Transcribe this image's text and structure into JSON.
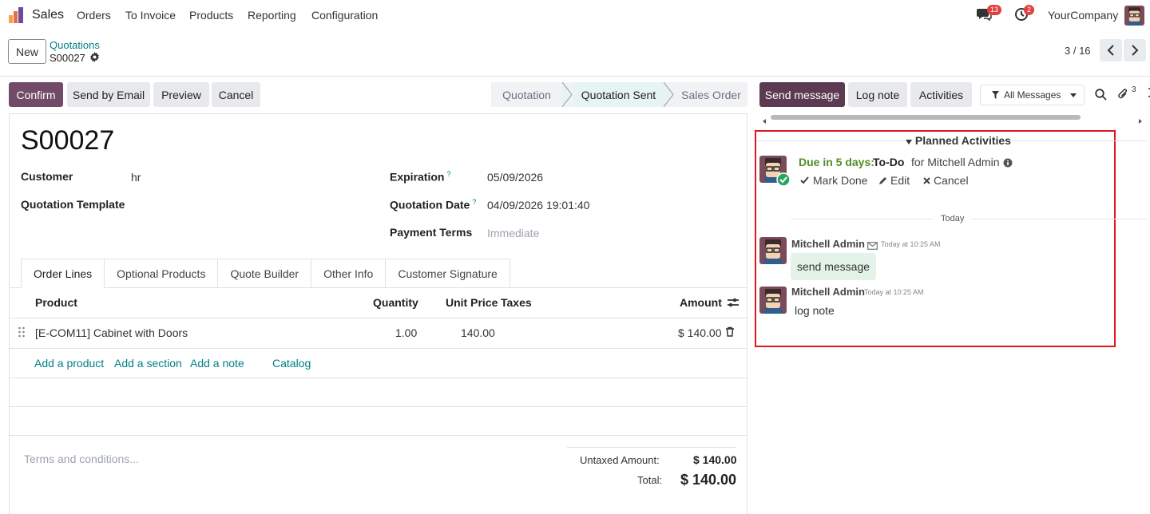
{
  "nav": {
    "app": "Sales",
    "items": [
      "Orders",
      "To Invoice",
      "Products",
      "Reporting",
      "Configuration"
    ],
    "chat_count": "13",
    "activity_count": "2",
    "company": "YourCompany"
  },
  "control": {
    "new_label": "New",
    "breadcrumb": "Quotations",
    "record": "S00027",
    "pager": "3 / 16"
  },
  "actions": {
    "confirm": "Confirm",
    "send_email": "Send by Email",
    "preview": "Preview",
    "cancel": "Cancel"
  },
  "status": {
    "stages": [
      "Quotation",
      "Quotation Sent",
      "Sales Order"
    ],
    "active": "Quotation Sent"
  },
  "form": {
    "name": "S00027",
    "customer_label": "Customer",
    "customer": "hr",
    "template_label": "Quotation Template",
    "expiration_label": "Expiration",
    "expiration": "05/09/2026",
    "qdate_label": "Quotation Date",
    "qdate": "04/09/2026 19:01:40",
    "terms_label": "Payment Terms",
    "terms_placeholder": "Immediate",
    "qmark": "?"
  },
  "tabs": [
    "Order Lines",
    "Optional Products",
    "Quote Builder",
    "Other Info",
    "Customer Signature"
  ],
  "lines": {
    "headers": {
      "product": "Product",
      "quantity": "Quantity",
      "unit_price": "Unit Price",
      "taxes": "Taxes",
      "amount": "Amount"
    },
    "rows": [
      {
        "product": "[E-COM11] Cabinet with Doors",
        "quantity": "1.00",
        "unit_price": "140.00",
        "amount": "$ 140.00"
      }
    ],
    "add_product": "Add a product",
    "add_section": "Add a section",
    "add_note": "Add a note",
    "catalog": "Catalog"
  },
  "footer": {
    "terms_placeholder": "Terms and conditions...",
    "untaxed_label": "Untaxed Amount:",
    "untaxed": "$ 140.00",
    "total_label": "Total:",
    "total": "$ 140.00"
  },
  "chatter": {
    "send_message": "Send message",
    "log_note": "Log note",
    "activities": "Activities",
    "filter": "All Messages",
    "attachments": "3",
    "planned_title": "Planned Activities",
    "due": "Due in 5 days:",
    "activity_type": "To-Do",
    "assigned": "for Mitchell Admin",
    "mark_done": "Mark Done",
    "edit": "Edit",
    "cancel": "Cancel",
    "today": "Today",
    "messages": [
      {
        "author": "Mitchell Admin",
        "time": "Today at 10:25 AM",
        "body": "send message"
      },
      {
        "author": "Mitchell Admin",
        "time": "Today at 10:25 AM",
        "body": "log note"
      }
    ]
  },
  "colors": {
    "primary": "#714b67",
    "link": "#017e84",
    "highlight": "#e3161f",
    "due": "#4f8f25"
  }
}
